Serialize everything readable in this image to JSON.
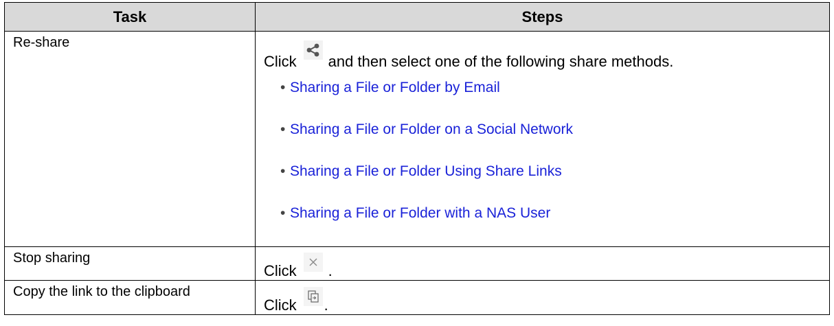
{
  "table": {
    "headers": {
      "task": "Task",
      "steps": "Steps"
    },
    "rows": [
      {
        "task": "Re-share",
        "click": "Click",
        "icon": "share-icon",
        "rest": "and then select one of the following share methods.",
        "links": [
          "Sharing a File or Folder by Email",
          "Sharing a File or Folder on a Social Network",
          "Sharing a File or Folder Using Share Links",
          "Sharing a File or Folder with a NAS User"
        ]
      },
      {
        "task": "Stop sharing",
        "click": "Click",
        "icon": "close-icon",
        "rest": "."
      },
      {
        "task": "Copy the link to the clipboard",
        "click": "Click",
        "icon": "copy-icon",
        "rest": "."
      }
    ]
  },
  "colors": {
    "header_bg": "#d9d9d9",
    "link": "#1a22d8",
    "border": "#000000"
  }
}
